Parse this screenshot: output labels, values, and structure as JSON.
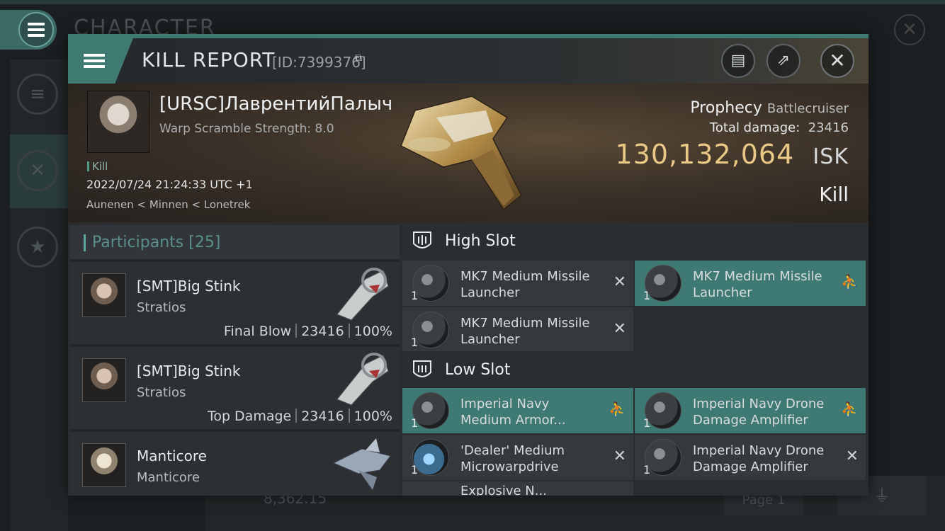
{
  "background": {
    "title": "CHARACTER",
    "isk_fragment": "8,362.15",
    "page_label": "Page 1"
  },
  "dialog": {
    "title": "KILL REPORT",
    "id": "[ID:7399376]"
  },
  "victim": {
    "name": "[URSC]ЛаврентийПалыч",
    "warp_strength": "Warp Scramble Strength: 8.0",
    "kill_tag": "Kill",
    "datetime": "2022/07/24 21:24:33 UTC +1",
    "location": "Aunenen < Minnen < Lonetrek",
    "ship_name": "Prophecy",
    "ship_class": "Battlecruiser",
    "total_damage_label": "Total damage:",
    "total_damage": "23416",
    "isk_value": "130,132,064",
    "isk_unit": "ISK",
    "result": "Kill"
  },
  "participants": {
    "label": "Participants",
    "count": "[25]",
    "rows": [
      {
        "name": "[SMT]Big Stink",
        "ship": "Stratios",
        "role": "Final Blow",
        "damage": "23416",
        "percent": "100%"
      },
      {
        "name": "[SMT]Big Stink",
        "ship": "Stratios",
        "role": "Top Damage",
        "damage": "23416",
        "percent": "100%"
      },
      {
        "name": "Manticore",
        "ship": "Manticore"
      }
    ]
  },
  "fitting": {
    "high_slot_label": "High Slot",
    "low_slot_label": "Low Slot",
    "high": [
      {
        "qty": "1",
        "name_line1": "MK7 Medium Missile",
        "name_line2": "Launcher",
        "status": "destroyed"
      },
      {
        "qty": "1",
        "name_line1": "MK7 Medium Missile",
        "name_line2": "Launcher",
        "status": "dropped"
      },
      {
        "qty": "1",
        "name_line1": "MK7 Medium Missile",
        "name_line2": "Launcher",
        "status": "destroyed"
      }
    ],
    "low": [
      {
        "qty": "1",
        "name_line1": "Imperial Navy",
        "name_line2": "Medium Armor...",
        "status": "dropped"
      },
      {
        "qty": "1",
        "name_line1": "Imperial Navy Drone",
        "name_line2": "Damage Amplifier",
        "status": "dropped"
      },
      {
        "qty": "1",
        "name_line1": "'Dealer' Medium",
        "name_line2": "Microwarpdrive",
        "status": "destroyed"
      },
      {
        "qty": "1",
        "name_line1": "Imperial Navy Drone",
        "name_line2": "Damage Amplifier",
        "status": "destroyed"
      }
    ],
    "partial_item_text": "Explosive N..."
  },
  "symbols": {
    "destroyed": "✕",
    "dropped": "⛹"
  },
  "colors": {
    "accent": "#3f7a73",
    "isk": "#e9c785",
    "dropped_bg": "#3e7a73"
  }
}
